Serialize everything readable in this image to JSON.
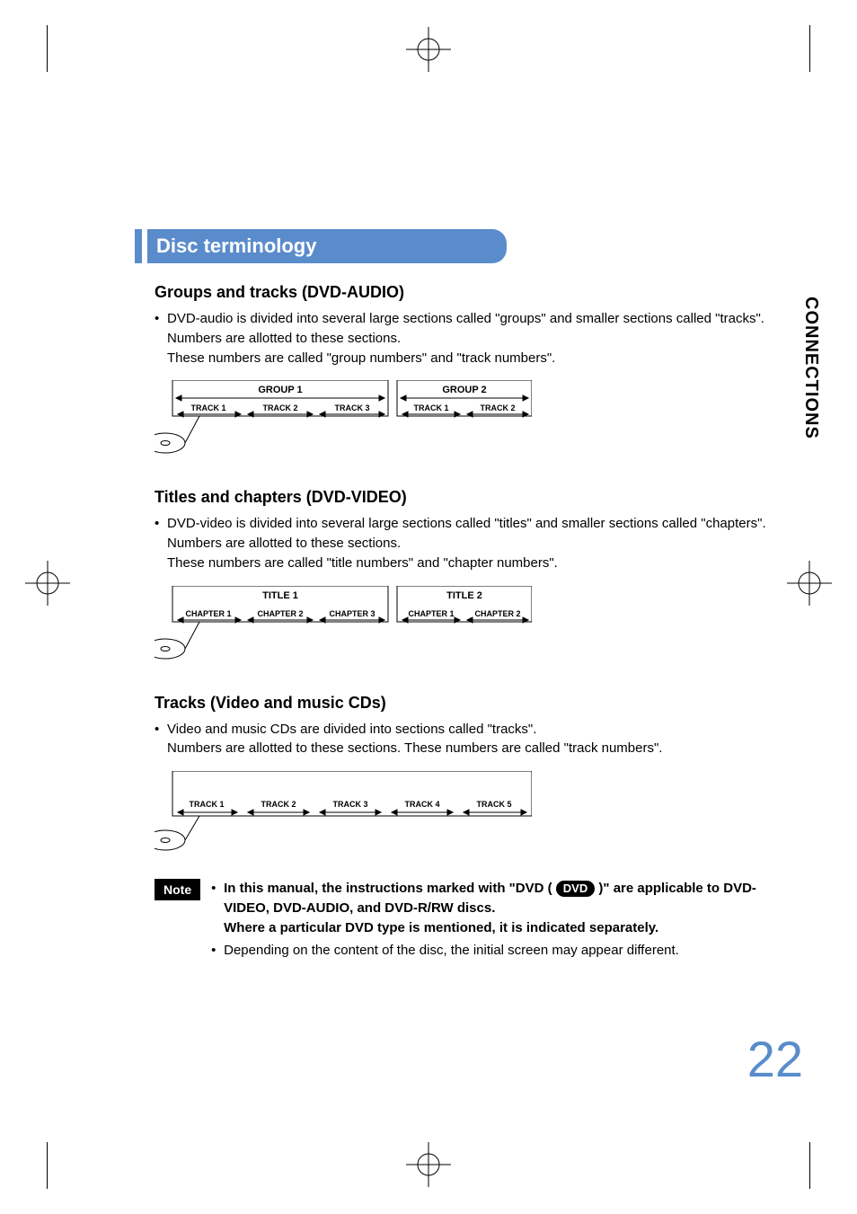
{
  "section_title": "Disc terminology",
  "side_tab": "CONNECTIONS",
  "page_number": "22",
  "sec1": {
    "heading": "Groups and tracks (DVD-AUDIO)",
    "text": "DVD-audio is divided into several large sections called \"groups\" and smaller sections called \"tracks\". Numbers are allotted to these sections.\nThese numbers are called \"group numbers\" and \"track numbers\".",
    "groups": [
      "GROUP 1",
      "GROUP 2"
    ],
    "tracks_g1": [
      "TRACK 1",
      "TRACK 2",
      "TRACK 3"
    ],
    "tracks_g2": [
      "TRACK 1",
      "TRACK 2"
    ]
  },
  "sec2": {
    "heading": "Titles and chapters (DVD-VIDEO)",
    "text": "DVD-video is divided into several large sections called \"titles\" and smaller sections called \"chapters\". Numbers are allotted to these sections.\nThese numbers are called \"title numbers\" and \"chapter numbers\".",
    "titles": [
      "TITLE 1",
      "TITLE 2"
    ],
    "chapters_t1": [
      "CHAPTER 1",
      "CHAPTER 2",
      "CHAPTER 3"
    ],
    "chapters_t2": [
      "CHAPTER 1",
      "CHAPTER 2"
    ]
  },
  "sec3": {
    "heading": "Tracks (Video and music CDs)",
    "text": "Video and music CDs are divided into sections called \"tracks\".\nNumbers are allotted to these sections. These numbers are called \"track numbers\".",
    "tracks": [
      "TRACK 1",
      "TRACK 2",
      "TRACK 3",
      "TRACK 4",
      "TRACK 5"
    ]
  },
  "note": {
    "label": "Note",
    "dvd_pill": "DVD",
    "line1_pre": "In this manual, the instructions marked with \"DVD (",
    "line1_post": ")\" are applicable to DVD-VIDEO, DVD-AUDIO, and DVD-R/RW discs.",
    "line2": "Where a particular DVD type is mentioned, it is indicated separately.",
    "line3": "Depending on the content of the disc, the initial screen may appear different."
  }
}
